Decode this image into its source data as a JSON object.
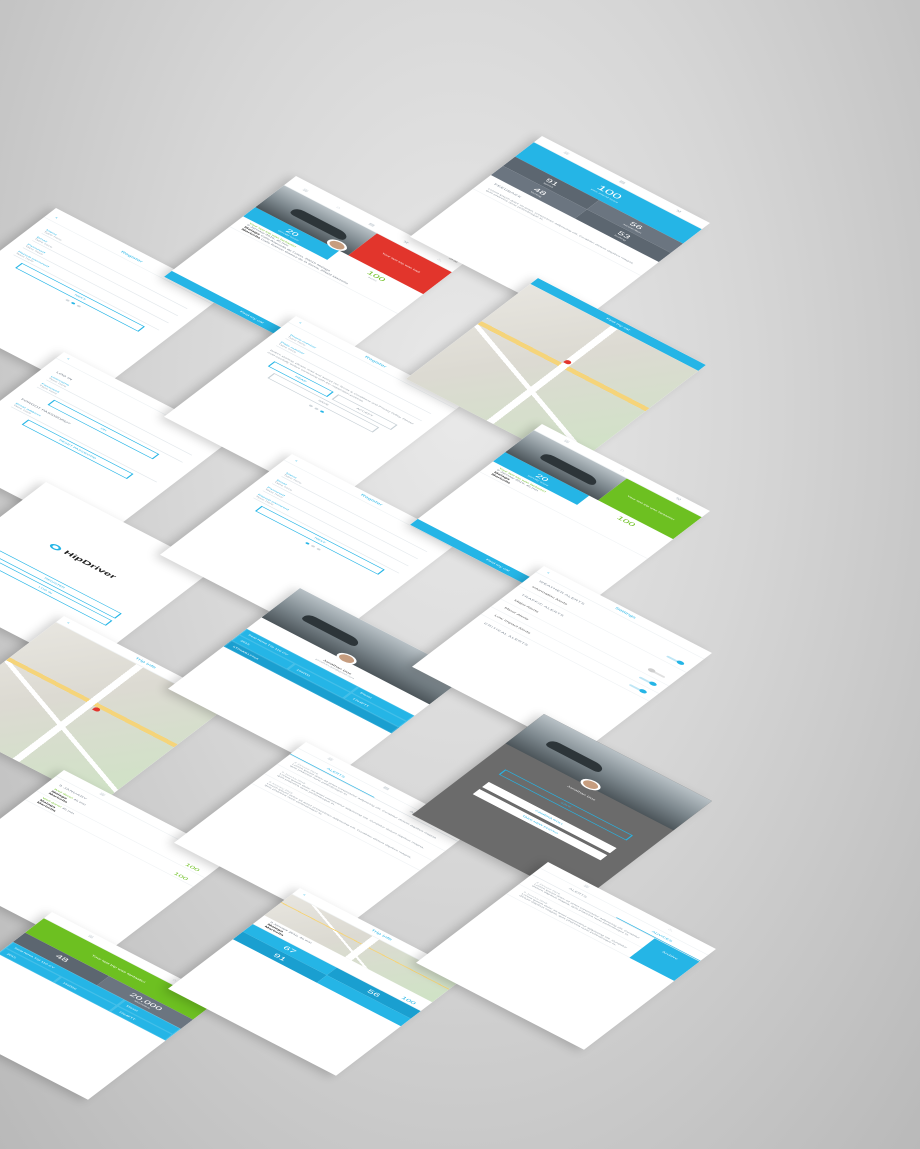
{
  "common": {
    "time": "10:00"
  },
  "register": {
    "title": "Register",
    "fields": [
      {
        "label": "Name",
        "value": "Type here"
      },
      {
        "label": "Email",
        "value": "Type here"
      },
      {
        "label": "Password",
        "value": "Type here"
      },
      {
        "label": "Repeat password",
        "value": "Type here"
      },
      {
        "label": "Phone number",
        "value": "Type here"
      },
      {
        "label": "Plate number",
        "value": "Type here"
      }
    ],
    "next": "NEXT",
    "terms_text": "Before starting, please read and accept our Terms & Conditions and Privacy Policy. Please read carefully before continuing with the registration process.",
    "read": "READ",
    "accept": "ACCEPT",
    "save": "SAVE"
  },
  "login": {
    "title": "LOG IN",
    "user_label": "Username",
    "user_value": "Type here",
    "pass_label": "Password",
    "pass_value": "Type here",
    "ok": "OK",
    "forgot": "FORGOT PASSWORD?",
    "email_label": "Email address",
    "email_value": "Type here",
    "reset": "RESET PASSWORD"
  },
  "splash": {
    "logo": "HipDriver",
    "register": "REGISTER",
    "login": "LOG IN"
  },
  "dashboard": {
    "name": "Jonathan",
    "status_bad": "Your last trip was bad",
    "status_good": "Your last trip was fantastic!",
    "score_left": "20",
    "score_left_cap": "penalty score",
    "score_right": "100",
    "score_right_cap": "score",
    "trip_date": "9 January 2016, 45 min",
    "from": "Malaga",
    "from_addr": "Calle Alameda de Colon, 29015 Malaga",
    "to": "Marbella",
    "to_addr": "Calle Ramon Gomez de la Serna, 29602 Marbella",
    "find_car": "Find my car",
    "rating_a": "100",
    "rating_b": "100"
  },
  "stats": {
    "big": "100",
    "big_cap": "your overall score",
    "a": "56",
    "a_cap": "acceleration",
    "b": "91",
    "b_cap": "speed",
    "c": "53",
    "c_cap": "braking",
    "d": "48",
    "d_cap": "turning",
    "feedback": "FEEDBACK",
    "feedback_text": "Lorem ipsum dolor sit amet, consectetur adipiscing elit. Curabitur dictum dapibus magna, quis pharetra nunc pellentesque in."
  },
  "profile": {
    "name": "Jonathan Doe",
    "email": "jonathan.doe@gmail.com",
    "car": "Seat Nova TSI 110 CV",
    "fuel": "Diesel",
    "year": "2015",
    "km": "156000",
    "plate": "7764FTT",
    "vin": "5T06AB17764"
  },
  "settings": {
    "title": "Settings",
    "weather": "WEATHER ALERTS",
    "information": "Information Alerts",
    "traffic": "TRAFFIC ALERTS",
    "major": "Major Alerts",
    "minor": "Minor Alerts",
    "low": "Low Impact Alerts",
    "critical": "CRITICAL ALERTS"
  },
  "alerts": {
    "tab_alerts": "ALERTS",
    "tab_advices": "ADVICES",
    "date": "9 January 2016",
    "text": "Lorem ipsum dolor sit amet consectetur adipiscing elit. Curabitur dictum dapibus magna, quis pharetra nunc pellentesque in.",
    "achieve": "Archive"
  },
  "trip_list": {
    "date": "9 JANUARY",
    "well_done": "Well done!",
    "duration": "45 min",
    "from": "Malaga",
    "to": "Marbella",
    "score": "100"
  },
  "trip_info": {
    "title": "Trip info",
    "a": "67",
    "b": "56",
    "c": "91",
    "d": "100"
  },
  "photo": {
    "name": "Jonathan Doe",
    "save": "SAVE",
    "camera": "CAMERA ROLL",
    "take": "TAKE NEW PHOTO"
  },
  "green_card": {
    "status": "Your last trip was fantastic!",
    "score": "48",
    "km": "20,000",
    "km_cap": "kilometers",
    "car": "Seat Nova TSI 110 CV",
    "fuel": "Diesel",
    "year": "2015",
    "km2": "156000",
    "plate": "7764FTT"
  }
}
